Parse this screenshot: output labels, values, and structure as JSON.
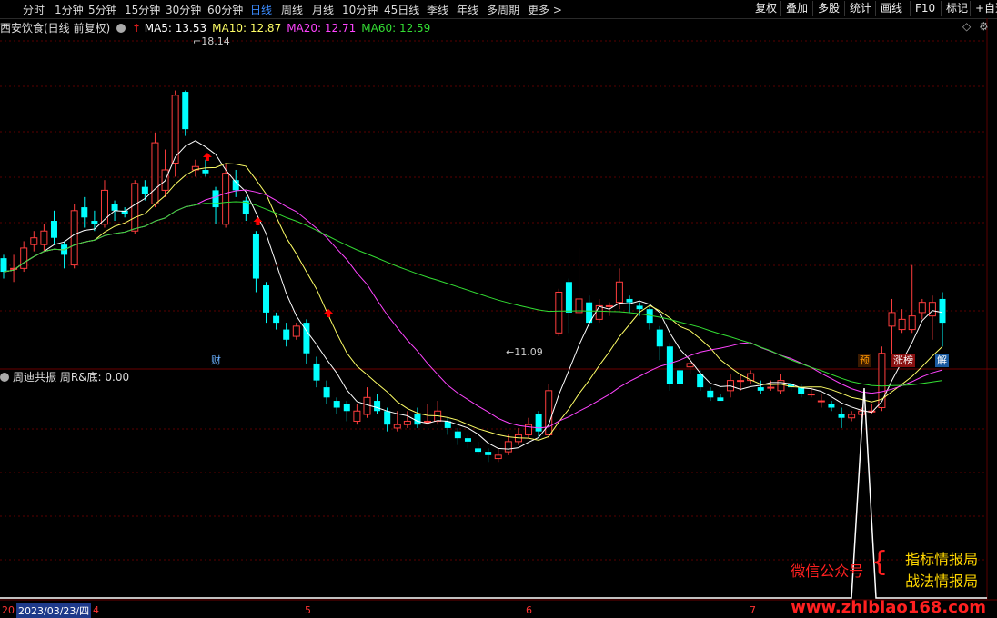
{
  "toolbar": {
    "tabs": [
      "分时",
      "1分钟",
      "5分钟",
      "15分钟",
      "30分钟",
      "60分钟",
      "日线",
      "周线",
      "月线",
      "10分钟",
      "45日线",
      "季线",
      "年线",
      "多周期",
      "更多 >"
    ],
    "active_tab": "日线",
    "right_buttons": [
      "复权",
      "叠加",
      "多股",
      "统计",
      "画线",
      "F10",
      "标记",
      "+自选"
    ]
  },
  "main_panel": {
    "title": "西安饮食(日线 前复权)",
    "ma": [
      {
        "label": "MA5: 13.53",
        "color": "#ffffff"
      },
      {
        "label": "MA10: 12.87",
        "color": "#ffff66"
      },
      {
        "label": "MA20: 12.71",
        "color": "#ff44ff"
      },
      {
        "label": "MA60: 12.59",
        "color": "#33dd33"
      }
    ],
    "high_label": "18.14",
    "low_label": "11.09",
    "badges": [
      {
        "text": "财",
        "color": "#6ab0ff",
        "bg": "#000"
      },
      {
        "text": "预",
        "color": "#ff9900",
        "bg": "#3a1a00"
      },
      {
        "text": "涨榜",
        "color": "#ffffff",
        "bg": "#8a1010"
      },
      {
        "text": "解",
        "color": "#ffffff",
        "bg": "#1a5aa0"
      }
    ]
  },
  "sub_panel": {
    "title": "周迪共振 周R&底: 0.00"
  },
  "x_axis": {
    "date_label": "2023/03/23/四",
    "month_labels": [
      "4",
      "5",
      "6",
      "7"
    ],
    "left_fragment": "20"
  },
  "watermark": {
    "left": "微信公众号",
    "right_top": "指标情报局",
    "right_bottom": "战法情报局",
    "url": "www.zhibiao168.com"
  },
  "colors": {
    "up": "#ff3d3d",
    "down": "#00ffff",
    "grid": "#5a0000",
    "arrow": "#ff0000"
  },
  "chart_data": {
    "type": "candlestick",
    "title": "西安饮食(日线 前复权)",
    "price_range": [
      10.5,
      19.6
    ],
    "max_price": 18.14,
    "min_price": 11.09,
    "candles": [
      [
        13.2,
        12.8,
        13.3,
        12.6
      ],
      [
        12.9,
        12.9,
        13.3,
        12.5
      ],
      [
        12.9,
        13.5,
        13.7,
        12.8
      ],
      [
        13.6,
        13.8,
        14.0,
        13.4
      ],
      [
        13.6,
        14.0,
        14.2,
        13.4
      ],
      [
        14.3,
        13.8,
        14.6,
        13.6
      ],
      [
        13.6,
        13.3,
        13.7,
        12.9
      ],
      [
        13.0,
        14.6,
        14.8,
        12.9
      ],
      [
        14.7,
        14.4,
        15.0,
        14.1
      ],
      [
        14.3,
        14.2,
        14.6,
        14.0
      ],
      [
        14.2,
        15.2,
        15.5,
        14.1
      ],
      [
        14.8,
        14.6,
        14.9,
        14.3
      ],
      [
        14.6,
        14.5,
        14.7,
        14.4
      ],
      [
        14.0,
        15.4,
        15.5,
        13.9
      ],
      [
        15.3,
        15.1,
        15.5,
        14.9
      ],
      [
        14.8,
        16.6,
        16.9,
        14.7
      ],
      [
        15.2,
        15.8,
        16.4,
        15.0
      ],
      [
        16.0,
        18.0,
        18.14,
        15.6
      ],
      [
        18.1,
        17.0,
        18.14,
        16.8
      ],
      [
        15.8,
        15.9,
        16.1,
        15.6
      ],
      [
        15.8,
        15.7,
        16.1,
        15.6
      ],
      [
        15.2,
        14.7,
        15.3,
        14.2
      ],
      [
        14.2,
        15.7,
        16.0,
        14.1
      ],
      [
        15.5,
        15.2,
        15.8,
        15.0
      ],
      [
        14.9,
        14.5,
        15.0,
        14.3
      ],
      [
        13.9,
        12.6,
        14.0,
        12.2
      ],
      [
        12.4,
        11.6,
        12.5,
        11.3
      ],
      [
        11.5,
        11.3,
        11.6,
        11.1
      ],
      [
        11.1,
        10.8,
        11.3,
        10.6
      ],
      [
        10.9,
        11.2,
        11.3,
        10.8
      ],
      [
        11.3,
        10.4,
        11.4,
        10.1
      ],
      [
        10.1,
        9.6,
        10.3,
        9.4
      ],
      [
        9.4,
        9.1,
        9.6,
        8.9
      ],
      [
        9.0,
        8.8,
        9.1,
        8.6
      ],
      [
        8.9,
        8.7,
        9.0,
        8.4
      ],
      [
        8.4,
        8.7,
        8.9,
        8.3
      ],
      [
        8.6,
        9.1,
        9.4,
        8.5
      ],
      [
        9.0,
        8.7,
        9.2,
        8.6
      ],
      [
        8.7,
        8.3,
        8.8,
        8.1
      ],
      [
        8.2,
        8.3,
        8.7,
        8.1
      ],
      [
        8.3,
        8.4,
        8.7,
        8.2
      ],
      [
        8.6,
        8.3,
        8.8,
        8.2
      ],
      [
        8.4,
        8.4,
        8.9,
        8.3
      ],
      [
        8.4,
        8.7,
        9.0,
        8.3
      ],
      [
        8.4,
        8.2,
        8.5,
        8.0
      ],
      [
        8.1,
        7.9,
        8.2,
        7.7
      ],
      [
        7.9,
        7.8,
        8.0,
        7.6
      ],
      [
        7.6,
        7.5,
        7.8,
        7.4
      ],
      [
        7.5,
        7.4,
        7.6,
        7.2
      ],
      [
        7.3,
        7.4,
        7.6,
        7.2
      ],
      [
        7.5,
        7.8,
        8.0,
        7.4
      ],
      [
        7.8,
        8.0,
        8.2,
        7.7
      ],
      [
        8.0,
        8.3,
        8.5,
        7.9
      ],
      [
        8.6,
        8.1,
        8.7,
        7.9
      ],
      [
        8.0,
        9.3,
        9.5,
        7.9
      ],
      [
        11.0,
        12.2,
        12.3,
        10.9
      ],
      [
        12.5,
        11.6,
        12.6,
        11.0
      ],
      [
        11.6,
        12.0,
        13.5,
        11.5
      ],
      [
        11.9,
        11.3,
        12.1,
        11.2
      ],
      [
        11.4,
        11.8,
        12.0,
        11.3
      ],
      [
        11.8,
        11.8,
        11.9,
        11.5
      ],
      [
        11.9,
        12.5,
        12.9,
        11.7
      ],
      [
        12.0,
        11.9,
        12.1,
        11.6
      ],
      [
        11.8,
        11.7,
        11.9,
        11.5
      ],
      [
        11.7,
        11.3,
        11.8,
        11.1
      ],
      [
        11.1,
        10.6,
        11.2,
        10.2
      ],
      [
        10.6,
        9.5,
        10.7,
        9.3
      ],
      [
        9.9,
        9.5,
        10.3,
        9.3
      ],
      [
        10.0,
        10.1,
        10.3,
        9.8
      ],
      [
        9.8,
        9.4,
        9.9,
        9.3
      ],
      [
        9.3,
        9.1,
        9.4,
        9.0
      ],
      [
        9.1,
        9.0,
        9.2,
        9.0
      ],
      [
        9.3,
        9.6,
        9.8,
        9.1
      ],
      [
        9.6,
        9.6,
        9.8,
        9.3
      ],
      [
        9.6,
        9.8,
        9.9,
        9.5
      ],
      [
        9.4,
        9.3,
        9.6,
        9.2
      ],
      [
        9.4,
        9.4,
        9.6,
        9.3
      ],
      [
        9.3,
        9.6,
        9.8,
        9.2
      ],
      [
        9.5,
        9.4,
        9.6,
        9.3
      ],
      [
        9.4,
        9.2,
        9.5,
        9.1
      ],
      [
        9.2,
        9.2,
        9.4,
        9.1
      ],
      [
        9.0,
        9.0,
        9.2,
        8.8
      ],
      [
        8.9,
        8.8,
        9.0,
        8.7
      ],
      [
        8.6,
        8.5,
        8.8,
        8.2
      ],
      [
        8.5,
        8.6,
        8.7,
        8.4
      ],
      [
        8.6,
        8.7,
        8.8,
        8.5
      ],
      [
        8.7,
        8.7,
        8.9,
        8.6
      ],
      [
        8.8,
        10.4,
        10.6,
        8.7
      ],
      [
        11.2,
        11.6,
        12.0,
        10.3
      ],
      [
        11.1,
        11.4,
        11.7,
        11.0
      ],
      [
        11.1,
        11.5,
        13.0,
        11.0
      ],
      [
        11.6,
        11.9,
        12.0,
        11.4
      ],
      [
        11.5,
        11.9,
        12.1,
        10.8
      ],
      [
        12.0,
        11.3,
        12.2,
        10.6
      ]
    ],
    "ma_series": [
      "MA5",
      "MA10",
      "MA20",
      "MA60"
    ],
    "indicator": {
      "name": "周迪共振",
      "field": "周R&底",
      "value": 0.0
    }
  }
}
